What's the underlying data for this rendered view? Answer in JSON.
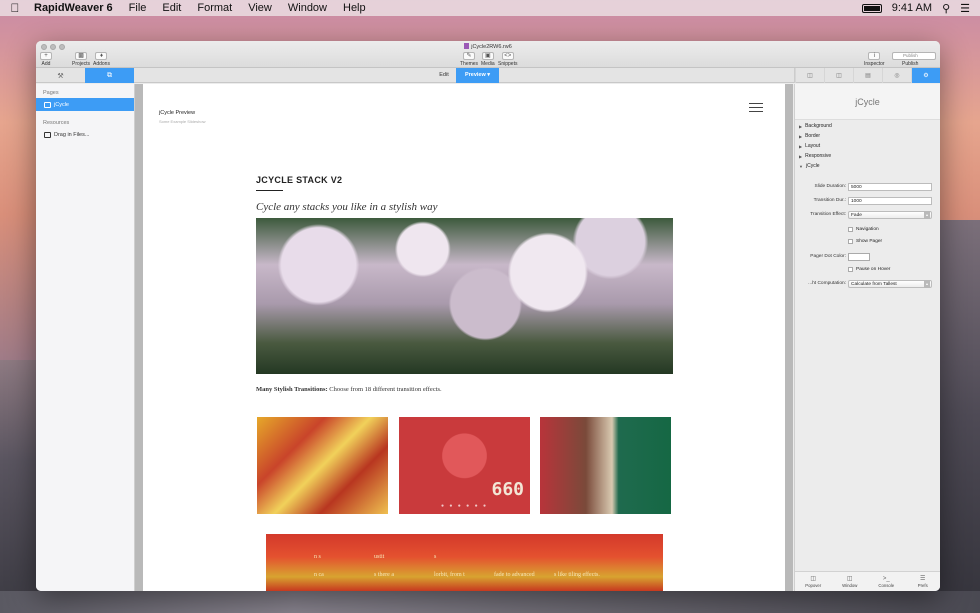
{
  "menubar": {
    "app_name": "RapidWeaver 6",
    "items": [
      "File",
      "Edit",
      "Format",
      "View",
      "Window",
      "Help"
    ],
    "clock": "9:41 AM"
  },
  "window": {
    "title": "jCycle2RW6.rw6",
    "toolbar": {
      "add": "Add",
      "projects": "Projects",
      "addons": "Addons",
      "themes": "Themes",
      "media": "Media",
      "snippets": "Snippets",
      "inspector": "Inspector",
      "publish": "Publish",
      "publish_menu": "Publish"
    },
    "tabs": {
      "edit": "Edit",
      "preview": "Preview"
    }
  },
  "sidebar": {
    "pages_header": "Pages",
    "pages": [
      {
        "label": "jCycle"
      }
    ],
    "resources_header": "Resources",
    "resources": [
      {
        "label": "Drag in Files..."
      }
    ]
  },
  "preview": {
    "site_title": "jCycle Preview",
    "site_subtitle": "Some Example Slideshow",
    "stack_title": "JCYCLE STACK V2",
    "tagline": "Cycle any stacks you like in a stylish way",
    "caption_bold": "Many Stylish Transitions:",
    "caption_text": " Choose from 18 different transition effects.",
    "tile_plate": "660",
    "tile_dots": "● ● ● ● ● ●",
    "banner_text_1": "n s",
    "banner_text_2": "ustit",
    "banner_text_3": "s",
    "banner_text_4": "n ca",
    "banner_text_5": "s there a",
    "banner_text_6": "lorbit, from t",
    "banner_text_7": "fade to advanced",
    "banner_text_8": "s like tiling effects."
  },
  "inspector": {
    "title": "jCycle",
    "groups": [
      "Background",
      "Border",
      "Layout",
      "Responsive",
      "jCycle"
    ],
    "fields": {
      "slide_duration_label": "Slide Duration:",
      "slide_duration_value": "5000",
      "transition_dur_label": "Transition Dur.:",
      "transition_dur_value": "1000",
      "transition_effect_label": "Transition Effect:",
      "transition_effect_value": "Fade",
      "navigation_label": "Navigation",
      "show_pager_label": "Show Pager",
      "pager_dot_color_label": "Pager Dot Color:",
      "pause_on_hover_label": "Pause on Hover",
      "ht_computation_label": "...ht Computation:",
      "ht_computation_value": "Calculate from Tallest"
    },
    "footer": [
      "Popover",
      "Window",
      "Console",
      "Prefs"
    ]
  },
  "colors": {
    "accent": "#3d9cf5"
  }
}
